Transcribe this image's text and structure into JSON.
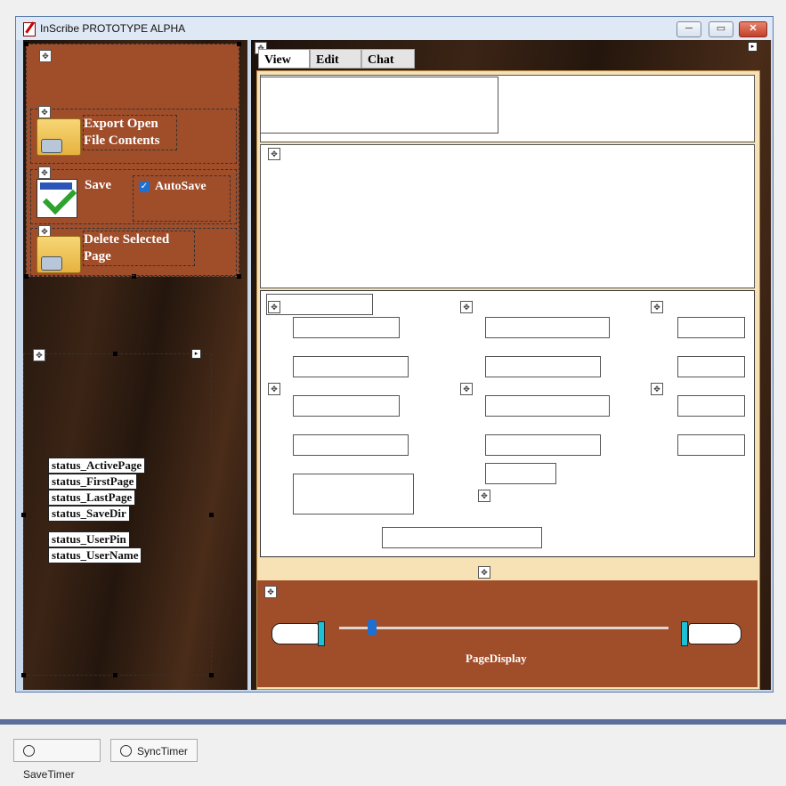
{
  "window": {
    "title": "InScribe PROTOTYPE ALPHA",
    "minimize": "─",
    "maximize": "▭",
    "close": "✕"
  },
  "toolbar": {
    "export_label": "Export Open File Contents",
    "save_label": "Save",
    "autosave_label": "AutoSave",
    "autosave_checked": true,
    "delete_label": "Delete Selected Page"
  },
  "status": {
    "active_page": "status_ActivePage",
    "first_page": "status_FirstPage",
    "last_page": "status_LastPage",
    "save_dir": "status_SaveDir",
    "user_pin": "status_UserPin",
    "user_name": "status_UserName"
  },
  "tabs": [
    "View",
    "Edit",
    "Chat"
  ],
  "footer": {
    "page_display": "PageDisplay",
    "slider_level": 0.1
  },
  "timers": [
    "SaveTimer",
    "SyncTimer"
  ],
  "colors": {
    "panel_rust": "#a04d2a",
    "content_beige": "#f6e2b5",
    "designer_bar": "#5b6f9a"
  },
  "icons": {
    "folder": "folder-icon",
    "save": "checkmark-icon",
    "prev_page": "pointing-hand-left-icon",
    "next_page": "pointing-hand-right-icon",
    "timer": "stopwatch-icon"
  }
}
